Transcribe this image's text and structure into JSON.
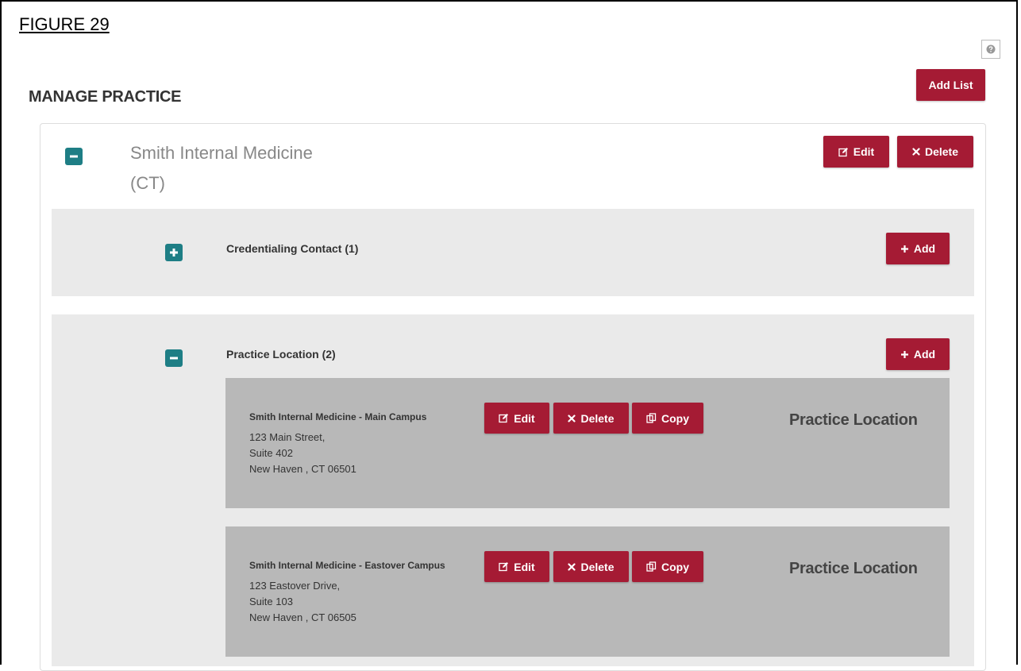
{
  "figure_label": "FIGURE 29",
  "page_title": "MANAGE PRACTICE",
  "add_list_label": "Add List",
  "practice": {
    "name_line1": "Smith Internal Medicine",
    "name_line2": "(CT)",
    "edit_label": "Edit",
    "delete_label": "Delete"
  },
  "sections": {
    "credentialing": {
      "title": "Credentialing Contact  (1)",
      "add_label": "Add",
      "expanded": false
    },
    "practice_location": {
      "title": "Practice Location  (2)",
      "add_label": "Add",
      "expanded": true
    }
  },
  "locations": [
    {
      "name": "Smith Internal Medicine - Main Campus",
      "line1": "123 Main Street,",
      "line2": "Suite 402",
      "line3": "New Haven , CT  06501",
      "edit_label": "Edit",
      "delete_label": "Delete",
      "copy_label": "Copy",
      "tag": "Practice Location"
    },
    {
      "name": "Smith Internal Medicine - Eastover Campus",
      "line1": "123 Eastover Drive,",
      "line2": "Suite 103",
      "line3": "New Haven , CT  06505",
      "edit_label": "Edit",
      "delete_label": "Delete",
      "copy_label": "Copy",
      "tag": "Practice Location"
    }
  ],
  "colors": {
    "button": "#a51b34",
    "toggle": "#1e7e85",
    "section_bg": "#eaeaea",
    "location_bg": "#b8b8b8"
  },
  "icons": [
    "question-icon",
    "minus-square-icon",
    "plus-square-icon",
    "edit-icon",
    "times-icon",
    "plus-icon",
    "copy-icon"
  ]
}
